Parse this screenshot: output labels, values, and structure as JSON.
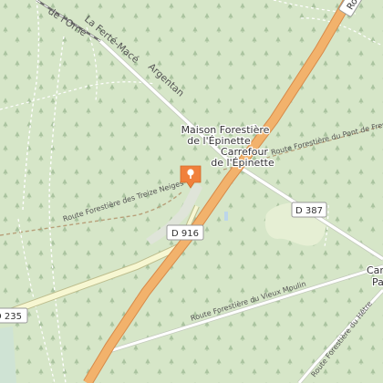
{
  "map": {
    "colors": {
      "forest": "#d6e6c8",
      "tree": "#aac39f",
      "clearing": "#e8f0d8",
      "primary_road": "#f2b26c",
      "primary_casing": "#d78a49",
      "tertiary_road": "#f7f7d2",
      "tertiary_casing": "#bdbd8d",
      "minor_road": "#ffffff",
      "minor_casing": "#c3c9bc",
      "path_dash": "#ffffff",
      "track": "#b8a07a",
      "rail": "#6b6b6b",
      "water": "#bcd6ea",
      "marker": "#f0803c",
      "shield_border": "#9a9a9a"
    },
    "roads": {
      "route_935": "Ro",
      "d916": "D 916",
      "d387": "D 387",
      "d235": "D 235"
    },
    "labels": {
      "la_ferte_mace": "La Ferté-Macé",
      "orne": "de l'Orne",
      "argentan": "Argentan",
      "maison_line1": "Maison Forestière",
      "maison_line2": "de l'Épinette",
      "carrefour_line1": "Carrefour",
      "carrefour_line2": "de l'Épinette",
      "route_treize_neiges": "Route Forestière des Treize Neiges",
      "route_pont_fresne": "Route Forestière du Pont de Fresne",
      "route_vieux_moulin": "Route Forestière du Vieux Moulin",
      "route_hetre": "Route Forestière du Hêtre",
      "edge_car": "Car",
      "edge_pa": "Pa"
    },
    "marker": {
      "icon": "map-pin-icon"
    }
  }
}
